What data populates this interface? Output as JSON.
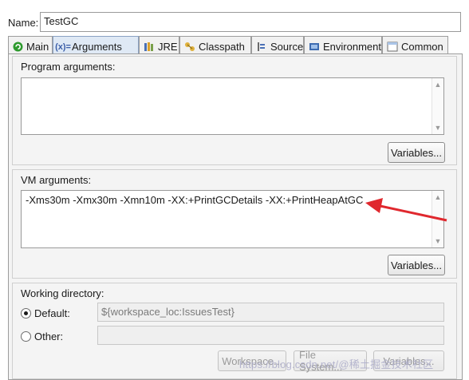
{
  "name": {
    "label": "Name:",
    "value": "TestGC"
  },
  "tabs": [
    {
      "label": "Main"
    },
    {
      "label": "Arguments"
    },
    {
      "label": "JRE"
    },
    {
      "label": "Classpath"
    },
    {
      "label": "Source"
    },
    {
      "label": "Environment"
    },
    {
      "label": "Common"
    }
  ],
  "program_args": {
    "title": "Program arguments:",
    "value": "",
    "variables_button": "Variables..."
  },
  "vm_args": {
    "title": "VM arguments:",
    "value": "-Xms30m -Xmx30m -Xmn10m -XX:+PrintGCDetails -XX:+PrintHeapAtGC",
    "variables_button": "Variables..."
  },
  "working_dir": {
    "title": "Working directory:",
    "default_label": "Default:",
    "default_value": "${workspace_loc:IssuesTest}",
    "other_label": "Other:",
    "other_value": "",
    "workspace_button": "Workspace...",
    "filesystem_button": "File System...",
    "variables_button": "Variables..."
  },
  "watermark": "https://blog.csdn.net/@稀土掘金技术社区",
  "colors": {
    "arrow": "#e0282e",
    "active_tab": "#dfe9f5"
  },
  "icons": {
    "main": "green-circle-icon",
    "arguments": "arguments-icon",
    "jre": "jre-library-icon",
    "classpath": "classpath-icon",
    "source": "source-icon",
    "environment": "environment-icon",
    "common": "common-icon"
  }
}
